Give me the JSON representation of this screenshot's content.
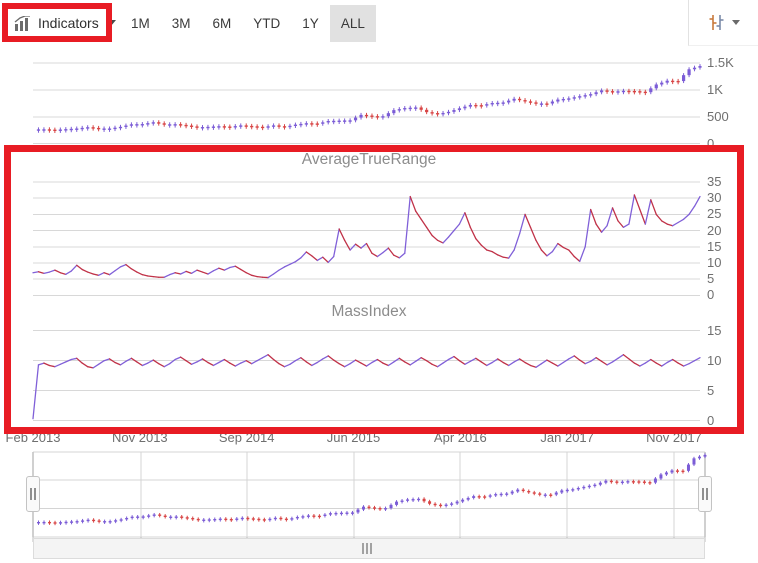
{
  "toolbar": {
    "indicators_label": "Indicators",
    "periods": [
      "1M",
      "3M",
      "6M",
      "YTD",
      "1Y",
      "ALL"
    ],
    "selected_period": "ALL"
  },
  "colors": {
    "annotation_red": "#e81c24",
    "candle_up": "#7b5cd6",
    "candle_down": "#d84545",
    "line_up": "#8060d8",
    "line_down": "#c03248",
    "grid": "#d8d8d8",
    "axis_text": "#6f6f6f",
    "title_text": "#8c8c8c"
  },
  "x_axis": {
    "ticks": [
      "Feb 2013",
      "Nov 2013",
      "Sep 2014",
      "Jun 2015",
      "Apr 2016",
      "Jan 2017",
      "Nov 2017"
    ]
  },
  "chart_data": [
    {
      "type": "candlestick",
      "name": "price",
      "y_ticks": [
        "1.5K",
        "1K",
        "500",
        "0"
      ],
      "ylim": [
        0,
        1500
      ],
      "legend": "none",
      "grid": true,
      "values": [
        264,
        265,
        266,
        260,
        254,
        262,
        269,
        275,
        281,
        293,
        305,
        292,
        280,
        281,
        281,
        296,
        312,
        336,
        359,
        362,
        364,
        381,
        398,
        378,
        358,
        360,
        362,
        349,
        336,
        320,
        304,
        308,
        312,
        318,
        324,
        318,
        313,
        326,
        339,
        330,
        322,
        314,
        305,
        322,
        339,
        324,
        310,
        332,
        354,
        367,
        380,
        376,
        372,
        396,
        421,
        425,
        429,
        432,
        434,
        485,
        536,
        524,
        512,
        511,
        511,
        568,
        625,
        644,
        664,
        670,
        675,
        631,
        587,
        570,
        552,
        572,
        593,
        626,
        659,
        690,
        722,
        718,
        715,
        736,
        758,
        763,
        769,
        803,
        837,
        813,
        789,
        770,
        750,
        750,
        749,
        786,
        823,
        834,
        845,
        866,
        886,
        905,
        924,
        959,
        994,
        981,
        968,
        978,
        987,
        984,
        980,
        970,
        961,
        1033,
        1105,
        1140,
        1176,
        1172,
        1169,
        1280,
        1390,
        1420,
        1450
      ]
    },
    {
      "type": "line",
      "title": "AverageTrueRange",
      "y_ticks": [
        "35",
        "30",
        "25",
        "20",
        "15",
        "10",
        "5",
        "0"
      ],
      "ylim": [
        0,
        35
      ],
      "grid": true,
      "values": [
        7.0,
        7.3,
        6.8,
        7.2,
        7.8,
        7.0,
        6.5,
        7.5,
        9.3,
        8.0,
        7.2,
        6.6,
        6.2,
        7.0,
        6.4,
        7.6,
        8.8,
        9.5,
        8.2,
        7.2,
        6.4,
        6.0,
        5.8,
        5.6,
        5.6,
        6.4,
        7.0,
        6.6,
        7.4,
        6.8,
        7.8,
        7.2,
        6.6,
        7.6,
        8.4,
        7.8,
        8.6,
        9.0,
        8.0,
        7.0,
        6.2,
        5.8,
        5.6,
        5.5,
        6.6,
        7.8,
        8.8,
        9.6,
        10.4,
        11.6,
        13.4,
        12.2,
        10.8,
        11.8,
        10.2,
        12.0,
        20.5,
        17.0,
        14.0,
        15.8,
        14.6,
        16.0,
        13.0,
        12.0,
        13.2,
        14.6,
        12.4,
        11.6,
        13.0,
        30.5,
        26.0,
        23.5,
        21.0,
        18.5,
        17.0,
        16.2,
        18.0,
        20.0,
        22.0,
        25.5,
        21.0,
        17.5,
        15.5,
        14.0,
        13.5,
        12.5,
        11.8,
        11.5,
        14.0,
        19.0,
        25.0,
        21.0,
        17.0,
        14.0,
        12.2,
        13.5,
        16.0,
        14.8,
        14.0,
        12.0,
        10.5,
        15.0,
        26.5,
        22.0,
        19.5,
        21.5,
        27.0,
        23.0,
        21.0,
        22.0,
        31.0,
        26.5,
        22.0,
        29.5,
        25.0,
        23.0,
        22.0,
        21.5,
        22.5,
        23.5,
        25.0,
        27.5,
        30.5
      ]
    },
    {
      "type": "line",
      "title": "MassIndex",
      "y_ticks": [
        "15",
        "10",
        "5",
        "0"
      ],
      "ylim": [
        0,
        15
      ],
      "grid": true,
      "values": [
        0.3,
        9.3,
        9.6,
        9.2,
        9.0,
        9.4,
        9.8,
        10.2,
        10.4,
        9.6,
        9.0,
        8.8,
        9.4,
        10.0,
        10.3,
        9.7,
        9.3,
        9.9,
        10.4,
        9.8,
        9.2,
        9.6,
        10.1,
        9.5,
        9.0,
        9.5,
        10.2,
        10.6,
        10.0,
        9.4,
        9.8,
        10.3,
        9.7,
        9.2,
        9.7,
        10.2,
        9.6,
        9.1,
        9.6,
        10.0,
        9.5,
        10.0,
        10.5,
        11.0,
        10.2,
        9.5,
        9.0,
        9.4,
        10.0,
        10.5,
        9.8,
        9.2,
        9.7,
        10.3,
        10.8,
        10.1,
        9.5,
        9.0,
        9.5,
        10.1,
        9.6,
        9.1,
        9.7,
        10.2,
        9.6,
        9.2,
        9.8,
        10.4,
        9.8,
        9.3,
        9.9,
        10.5,
        10.0,
        9.4,
        9.0,
        9.6,
        10.2,
        10.7,
        10.0,
        9.4,
        9.9,
        10.4,
        9.8,
        9.2,
        9.7,
        10.3,
        9.7,
        9.2,
        9.8,
        10.3,
        9.7,
        9.2,
        8.9,
        9.5,
        10.1,
        9.6,
        9.1,
        9.7,
        10.3,
        10.8,
        10.1,
        9.5,
        9.9,
        10.5,
        9.9,
        9.3,
        9.8,
        10.4,
        11.0,
        10.3,
        9.6,
        9.1,
        9.6,
        10.2,
        9.6,
        9.1,
        9.7,
        10.2,
        9.6,
        9.1,
        9.5,
        10.0,
        10.5
      ]
    },
    {
      "type": "candlestick",
      "name": "range-navigator-preview",
      "note": "same price series rendered small in the range selector",
      "ylim": [
        0,
        1500
      ]
    }
  ]
}
